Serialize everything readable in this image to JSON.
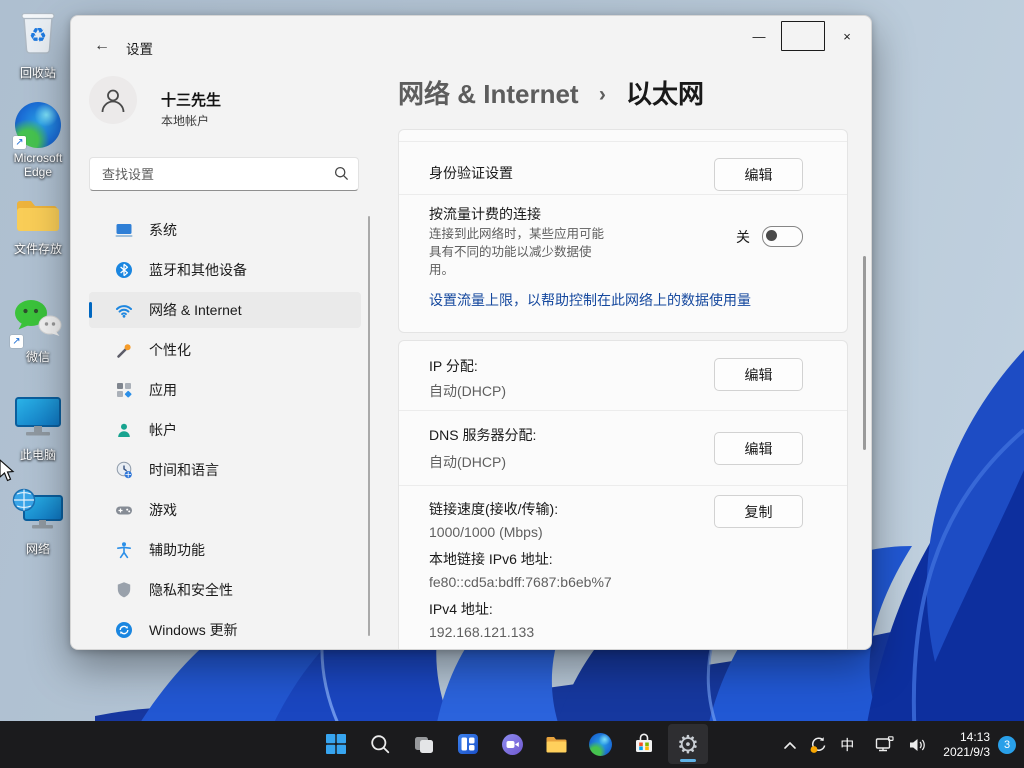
{
  "colors": {
    "accent": "#0067c0",
    "link_blue": "#15489e",
    "taskbar_background": "#1b1b1d",
    "active_indicator": "#5fb2e6",
    "badge_blue": "#29a0e9",
    "selected_nav_background": "#eaeaea"
  },
  "desktop": {
    "icons": [
      {
        "name": "recycle-bin",
        "label": "回收站"
      },
      {
        "name": "microsoft-edge",
        "label": "Microsoft Edge"
      },
      {
        "name": "file-storage-folder",
        "label": "文件存放"
      },
      {
        "name": "wechat",
        "label": "微信"
      },
      {
        "name": "this-pc",
        "label": "此电脑"
      },
      {
        "name": "network-neighborhood",
        "label": "网络"
      }
    ]
  },
  "settings_window": {
    "titlebar": {
      "back_glyph": "←",
      "title": "设置",
      "minimize_glyph": "—",
      "close_glyph": "×"
    },
    "user": {
      "name": "十三先生",
      "account_type": "本地帐户"
    },
    "search": {
      "placeholder": "查找设置"
    },
    "nav_items": [
      {
        "label": "系统",
        "icon": "system-icon",
        "selected": false
      },
      {
        "label": "蓝牙和其他设备",
        "icon": "bluetooth-icon",
        "selected": false
      },
      {
        "label": "网络 & Internet",
        "icon": "network-internet-icon",
        "selected": true
      },
      {
        "label": "个性化",
        "icon": "personalization-icon",
        "selected": false
      },
      {
        "label": "应用",
        "icon": "apps-icon",
        "selected": false
      },
      {
        "label": "帐户",
        "icon": "accounts-icon",
        "selected": false
      },
      {
        "label": "时间和语言",
        "icon": "time-language-icon",
        "selected": false
      },
      {
        "label": "游戏",
        "icon": "gaming-icon",
        "selected": false
      },
      {
        "label": "辅助功能",
        "icon": "accessibility-icon",
        "selected": false
      },
      {
        "label": "隐私和安全性",
        "icon": "privacy-security-icon",
        "selected": false
      },
      {
        "label": "Windows 更新",
        "icon": "windows-update-icon",
        "selected": false
      }
    ],
    "breadcrumb": {
      "parent": "网络 & Internet",
      "separator": "›",
      "current": "以太网"
    },
    "sections": {
      "authentication": {
        "title": "身份验证设置",
        "button_label": "编辑"
      },
      "metered": {
        "title": "按流量计费的连接",
        "description_lines": [
          "连接到此网络时，某些应用可能",
          "具有不同的功能以减少数据使",
          "用。"
        ],
        "toggle_label": "关",
        "toggle_state": "off",
        "data_limit_link": "设置流量上限，以帮助控制在此网络上的数据使用量"
      },
      "ip_assignment": {
        "title": "IP 分配:",
        "value": "自动(DHCP)",
        "button_label": "编辑"
      },
      "dns_assignment": {
        "title": "DNS 服务器分配:",
        "value": "自动(DHCP)",
        "button_label": "编辑"
      },
      "link_details": {
        "speed_label": "链接速度(接收/传输):",
        "speed_value": "1000/1000 (Mbps)",
        "ipv6_label": "本地链接 IPv6 地址:",
        "ipv6_value": "fe80::cd5a:bdff:7687:b6eb%7",
        "ipv4_label": "IPv4 地址:",
        "ipv4_value": "192.168.121.133",
        "button_label": "复制"
      }
    }
  },
  "taskbar": {
    "icons": [
      "start",
      "search",
      "task-view",
      "widgets",
      "chat",
      "file-explorer",
      "edge",
      "store",
      "settings"
    ],
    "active_icon": "settings",
    "tray": {
      "ime_label": "中",
      "time": "14:13",
      "date": "2021/9/3",
      "notification_count": "3"
    }
  }
}
